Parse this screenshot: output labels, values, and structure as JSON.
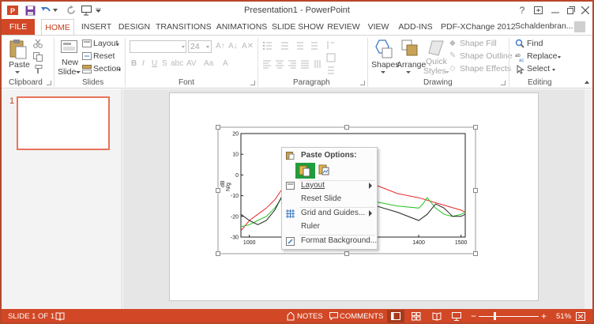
{
  "window": {
    "title": "Presentation1 - PowerPoint"
  },
  "tabs": [
    "FILE",
    "HOME",
    "INSERT",
    "DESIGN",
    "TRANSITIONS",
    "ANIMATIONS",
    "SLIDE SHOW",
    "REVIEW",
    "VIEW",
    "ADD-INS",
    "PDF-XChange 2012"
  ],
  "account": "Schaldenbran...",
  "ribbon": {
    "clipboard": {
      "paste": "Paste",
      "label": "Clipboard"
    },
    "slides": {
      "new_slide_1": "New",
      "new_slide_2": "Slide",
      "layout": "Layout",
      "reset": "Reset",
      "section": "Section",
      "label": "Slides"
    },
    "font": {
      "size": "24",
      "label": "Font"
    },
    "paragraph": {
      "label": "Paragraph"
    },
    "drawing": {
      "shapes": "Shapes",
      "arrange": "Arrange",
      "quick_styles_1": "Quick",
      "quick_styles_2": "Styles",
      "shape_fill": "Shape Fill",
      "shape_outline": "Shape Outline",
      "shape_effects": "Shape Effects",
      "label": "Drawing"
    },
    "editing": {
      "find": "Find",
      "replace": "Replace",
      "select": "Select",
      "label": "Editing"
    }
  },
  "thumbnails": {
    "number": "1"
  },
  "context_menu": {
    "header": "Paste Options:",
    "layout": "Layout",
    "reset_slide": "Reset Slide",
    "grid_guides": "Grid and Guides...",
    "ruler": "Ruler",
    "format_background": "Format Background..."
  },
  "statusbar": {
    "slide": "SLIDE 1 OF 1",
    "notes": "NOTES",
    "comments": "COMMENTS",
    "zoom": "51%"
  },
  "colors": {
    "accent": "#d24726",
    "active_tab_text": "#c43e1c",
    "highlight": "#1e9e3c"
  },
  "chart_data": {
    "type": "line",
    "ylabel_1": "dB",
    "ylabel_2": "N/g",
    "yticks": [
      "20",
      "10",
      "0",
      "-10",
      "-20",
      "-30"
    ],
    "xticks": [
      "1000",
      "1400",
      "1500"
    ],
    "ylim": [
      -30,
      20
    ],
    "xlim": [
      980,
      1510
    ],
    "series": [
      {
        "color": "#e8282a",
        "x": [
          980,
          1000,
          1020,
          1040,
          1060,
          1080,
          1100,
          1110,
          1150,
          1200,
          1250,
          1300,
          1350,
          1400,
          1450,
          1500,
          1510
        ],
        "y": [
          -27,
          -22,
          -19,
          -16,
          -12,
          -6,
          0,
          -2,
          10,
          6,
          -1,
          -5,
          -9,
          -11,
          -14,
          -17,
          -18
        ]
      },
      {
        "color": "#22c322",
        "x": [
          980,
          1000,
          1020,
          1040,
          1060,
          1080,
          1100,
          1110,
          1200,
          1250,
          1300,
          1350,
          1400,
          1410,
          1420,
          1440,
          1460,
          1480,
          1500,
          1510
        ],
        "y": [
          -25,
          -24,
          -22,
          -20,
          -16,
          -10,
          -1,
          -4,
          -2,
          -8,
          -13,
          -15,
          -16,
          -14,
          -11,
          -16,
          -19,
          -20,
          -19,
          -18
        ]
      },
      {
        "color": "#222222",
        "x": [
          980,
          1000,
          1020,
          1040,
          1060,
          1080,
          1100,
          1110,
          1200,
          1250,
          1300,
          1350,
          1400,
          1420,
          1440,
          1460,
          1480,
          1500,
          1510
        ],
        "y": [
          -19,
          -22,
          -24,
          -22,
          -17,
          -9,
          -1,
          -5,
          -3,
          -10,
          -15,
          -18,
          -22,
          -19,
          -14,
          -16,
          -20,
          -20,
          -19
        ]
      }
    ]
  }
}
